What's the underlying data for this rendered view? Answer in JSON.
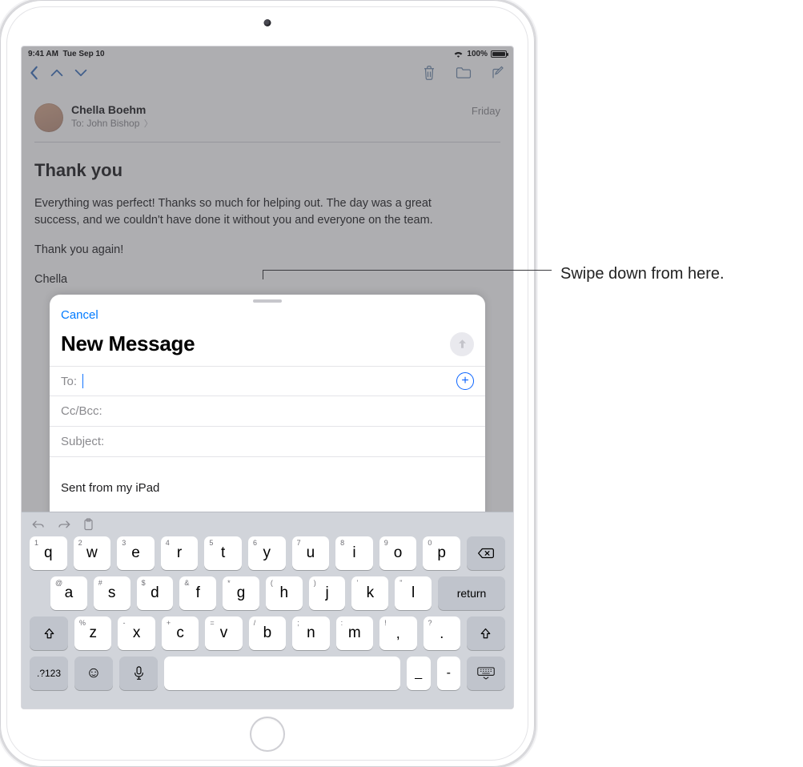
{
  "status": {
    "time": "9:41 AM",
    "date": "Tue Sep 10",
    "batteryPct": "100%"
  },
  "nav": {},
  "mail": {
    "from": "Chella Boehm",
    "toLabel": "To:",
    "toName": "John Bishop",
    "date": "Friday",
    "subject": "Thank you",
    "para1": "Everything was perfect! Thanks so much for helping out. The day was a great success, and we couldn't have done it without you and everyone on the team.",
    "para2": "Thank you again!",
    "sig": "Chella"
  },
  "compose": {
    "cancel": "Cancel",
    "title": "New Message",
    "toLabel": "To:",
    "ccLabel": "Cc/Bcc:",
    "subjectLabel": "Subject:",
    "signature": "Sent from my iPad"
  },
  "keyboard": {
    "row1": [
      {
        "k": "q",
        "h": "1"
      },
      {
        "k": "w",
        "h": "2"
      },
      {
        "k": "e",
        "h": "3"
      },
      {
        "k": "r",
        "h": "4"
      },
      {
        "k": "t",
        "h": "5"
      },
      {
        "k": "y",
        "h": "6"
      },
      {
        "k": "u",
        "h": "7"
      },
      {
        "k": "i",
        "h": "8"
      },
      {
        "k": "o",
        "h": "9"
      },
      {
        "k": "p",
        "h": "0"
      }
    ],
    "row2": [
      {
        "k": "a",
        "h": "@"
      },
      {
        "k": "s",
        "h": "#"
      },
      {
        "k": "d",
        "h": "$"
      },
      {
        "k": "f",
        "h": "&"
      },
      {
        "k": "g",
        "h": "*"
      },
      {
        "k": "h",
        "h": "("
      },
      {
        "k": "j",
        "h": ")"
      },
      {
        "k": "k",
        "h": "'"
      },
      {
        "k": "l",
        "h": "\""
      }
    ],
    "row3": [
      {
        "k": "z",
        "h": "%"
      },
      {
        "k": "x",
        "h": "-"
      },
      {
        "k": "c",
        "h": "+"
      },
      {
        "k": "v",
        "h": "="
      },
      {
        "k": "b",
        "h": "/"
      },
      {
        "k": "n",
        "h": ";"
      },
      {
        "k": "m",
        "h": ":"
      }
    ],
    "row3extra": [
      {
        "k": "!",
        "h": ","
      },
      {
        "k": "?",
        "h": "."
      }
    ],
    "returnLabel": "return",
    "symLabel": ".?123",
    "underscore": "_",
    "dash": "-"
  },
  "callout": "Swipe down from here."
}
